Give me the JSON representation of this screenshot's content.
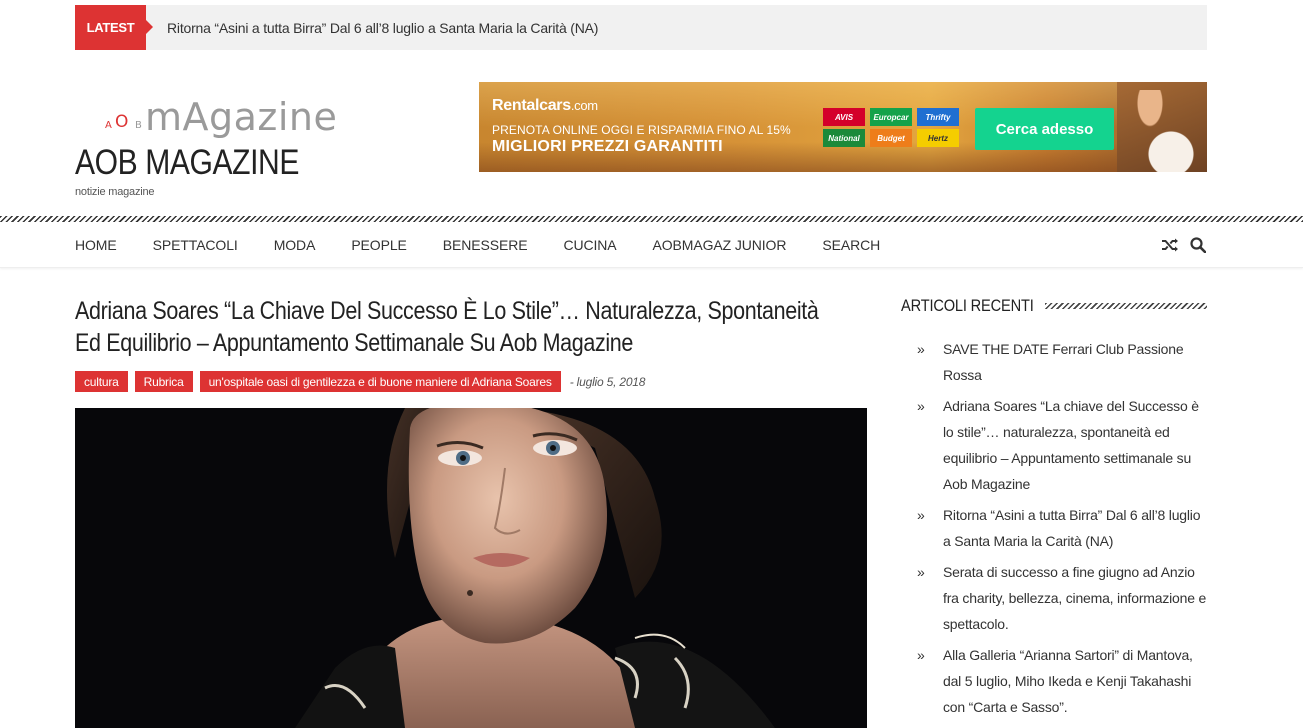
{
  "ticker": {
    "label": "LATEST",
    "headline": "Ritorna “Asini a tutta Birra” Dal 6 all’8 luglio a Santa Maria la Carità (NA)"
  },
  "logo": {
    "small_a": "A",
    "small_o": "O",
    "small_b": "B",
    "magazine": "mAgazine",
    "title": "AOB MAGAZINE",
    "tagline": "notizie magazine"
  },
  "banner": {
    "brand": "Rentalcars",
    "brand_suffix": ".com",
    "line1": "PRENOTA ONLINE OGGI E RISPARMIA FINO AL 15%",
    "line2": "MIGLIORI PREZZI GARANTITI",
    "partners": [
      {
        "name": "AVIS",
        "color": "#d4002a"
      },
      {
        "name": "Europcar",
        "color": "#14a24a"
      },
      {
        "name": "Thrifty",
        "color": "#1f6fd1"
      },
      {
        "name": "National",
        "color": "#1b8a3a"
      },
      {
        "name": "Budget",
        "color": "#ee7d1a"
      },
      {
        "name": "Hertz",
        "color": "#f5cd00"
      }
    ],
    "cta": "Cerca adesso"
  },
  "nav": {
    "items": [
      "HOME",
      "SPETTACOLI",
      "MODA",
      "PEOPLE",
      "BENESSERE",
      "CUCINA",
      "AOBMAGAZ JUNIOR",
      "SEARCH"
    ],
    "icons": [
      "shuffle-icon",
      "search-icon"
    ]
  },
  "article": {
    "title": "Adriana Soares “La Chiave Del Successo È Lo Stile”… Naturalezza, Spontaneità Ed Equilibrio – Appuntamento Settimanale Su Aob Magazine",
    "categories": [
      "cultura",
      "Rubrica",
      "un'ospitale oasi di gentilezza e di buone maniere di Adriana Soares"
    ],
    "date": "- luglio 5, 2018"
  },
  "sidebar": {
    "title": "ARTICOLI RECENTI",
    "bullet": "»",
    "items": [
      "SAVE THE DATE Ferrari Club Passione Rossa",
      "Adriana Soares “La chiave del Successo è lo stile”… naturalezza, spontaneità ed equilibrio – Appuntamento settimanale su Aob Magazine",
      "Ritorna “Asini a tutta Birra” Dal 6 all’8 luglio a Santa Maria la Carità (NA)",
      "Serata di successo a fine giugno ad Anzio fra charity, bellezza, cinema, informazione e spettacolo.",
      "Alla Galleria “Arianna Sartori” di Mantova, dal 5 luglio, Miho Ikeda e Kenji Takahashi con “Carta e Sasso”."
    ]
  },
  "colors": {
    "accent": "#dd3333",
    "cta": "#14d38f",
    "ticker_bg": "#f1f1f1"
  }
}
